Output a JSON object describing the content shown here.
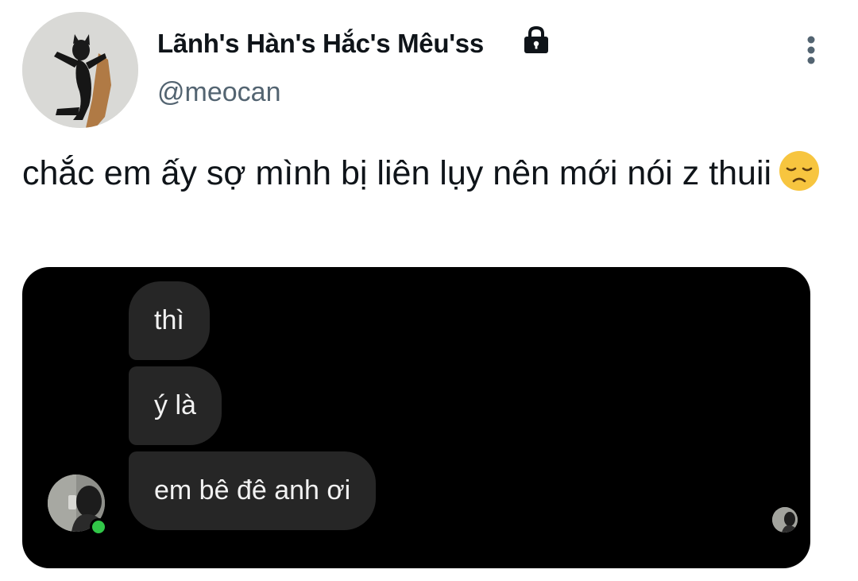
{
  "tweet": {
    "author": {
      "display_name": "Lãnh's Hàn's Hắc's Mêu'ss",
      "handle": "@meocan",
      "avatar_icon": "cat-photo-avatar",
      "protected_icon": "lock-icon"
    },
    "menu_icon": "more-vertical-icon",
    "text": "chắc em ấy sợ mình bị liên lụy nên mới nói z thuii",
    "emoji_icon": "disappointed-face-emoji"
  },
  "media": {
    "background": "#000000",
    "bubble_color": "#262626",
    "messages": [
      {
        "text": "thì"
      },
      {
        "text": "ý là"
      },
      {
        "text": "em bê đê anh ơi"
      }
    ],
    "online_status_color": "#31c748"
  }
}
